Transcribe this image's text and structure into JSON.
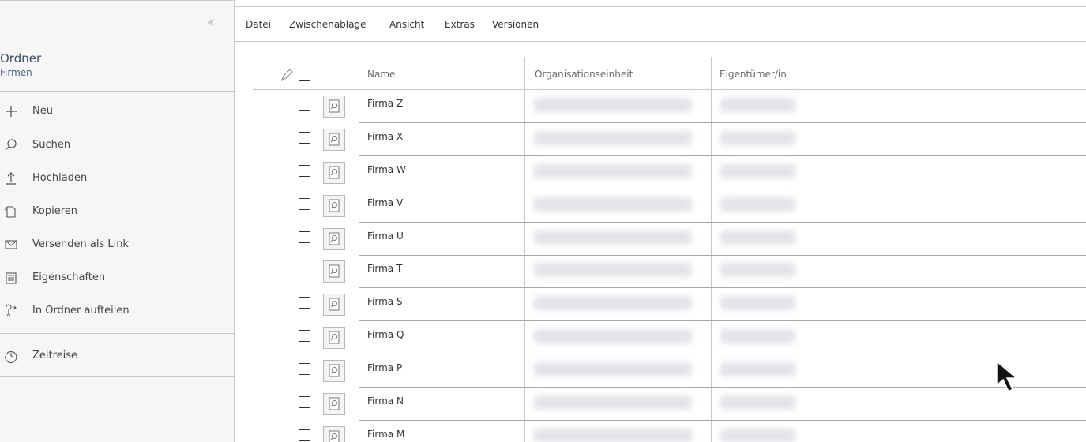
{
  "sidebar": {
    "collapse_glyph": "«",
    "title": "Ordner",
    "subtitle": "Firmen",
    "items": [
      {
        "label": "Neu",
        "icon": "plus-icon"
      },
      {
        "label": "Suchen",
        "icon": "search-icon"
      },
      {
        "label": "Hochladen",
        "icon": "upload-icon"
      },
      {
        "label": "Kopieren",
        "icon": "copy-icon"
      },
      {
        "label": "Versenden als Link",
        "icon": "mail-icon"
      },
      {
        "label": "Eigenschaften",
        "icon": "properties-icon"
      },
      {
        "label": "In Ordner aufteilen",
        "icon": "split-folder-icon"
      }
    ],
    "extra_item": {
      "label": "Zeitreise",
      "icon": "time-travel-icon"
    }
  },
  "menu": {
    "items": [
      "Datei",
      "Zwischenablage",
      "Ansicht",
      "Extras",
      "Versionen"
    ]
  },
  "table": {
    "columns": [
      "Name",
      "Organisationseinheit",
      "Eigentümer/in"
    ],
    "rows": [
      {
        "name": "Firma Z"
      },
      {
        "name": "Firma X"
      },
      {
        "name": "Firma W"
      },
      {
        "name": "Firma V"
      },
      {
        "name": "Firma U"
      },
      {
        "name": "Firma T"
      },
      {
        "name": "Firma S"
      },
      {
        "name": "Firma Q"
      },
      {
        "name": "Firma P"
      },
      {
        "name": "Firma N"
      },
      {
        "name": "Firma M"
      }
    ]
  },
  "colors": {
    "accent": "#3c4e6a",
    "border": "#c8c8c8",
    "sidebar_bg": "#f6f6f6"
  }
}
